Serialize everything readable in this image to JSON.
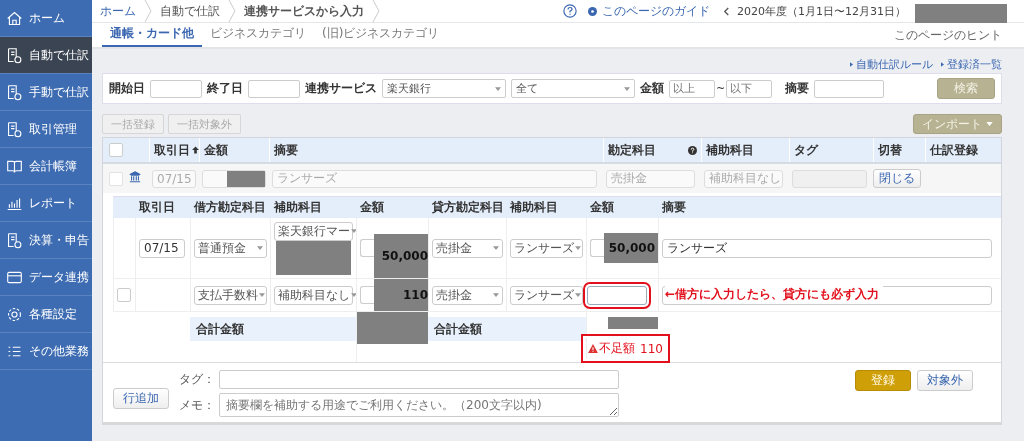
{
  "sidebar": {
    "items": [
      {
        "label": "ホーム",
        "selected": false
      },
      {
        "label": "自動で仕訳",
        "selected": true
      },
      {
        "label": "手動で仕訳",
        "selected": false
      },
      {
        "label": "取引管理",
        "selected": false
      },
      {
        "label": "会計帳簿",
        "selected": false
      },
      {
        "label": "レポート",
        "selected": false
      },
      {
        "label": "決算・申告",
        "selected": false
      },
      {
        "label": "データ連携",
        "selected": false
      },
      {
        "label": "各種設定",
        "selected": false
      },
      {
        "label": "その他業務",
        "selected": false
      }
    ]
  },
  "breadcrumb": [
    "ホーム",
    "自動で仕訳",
    "連携サービスから入力"
  ],
  "header": {
    "guide_link": "このページのガイド",
    "fiscal_year": "2020年度（1月1日〜12月31日）",
    "hint_link": "このページのヒント"
  },
  "tabs": [
    {
      "label": "通帳・カード他",
      "selected": true
    },
    {
      "label": "ビジネスカテゴリ",
      "selected": false
    },
    {
      "label": "(旧)ビジネスカテゴリ",
      "selected": false
    }
  ],
  "links": [
    "自動仕訳ルール",
    "登録済一覧"
  ],
  "filters": {
    "start_label": "開始日",
    "end_label": "終了日",
    "service_label": "連携サービス",
    "service_value": "楽天銀行",
    "category_value": "全て",
    "amount_label": "金額",
    "amount_min_placeholder": "以上",
    "tilde": "~",
    "amount_max_placeholder": "以下",
    "memo_label": "摘要",
    "search_button": "検索"
  },
  "bulk_buttons": [
    "一括登録",
    "一括対象外"
  ],
  "import_button": "インポート",
  "table": {
    "all_checked": false,
    "columns": [
      "取引日",
      "金額",
      "摘要",
      "勘定科目",
      "補助科目",
      "タグ",
      "切替",
      "仕訳登録"
    ],
    "row": {
      "checked": false,
      "date": "07/15",
      "memo": "ランサーズ",
      "account": "売掛金",
      "sub_account": "補助科目なし",
      "toggle_button": "閉じる"
    }
  },
  "entry": {
    "columns": [
      "取引日",
      "借方勘定科目",
      "補助科目",
      "金額",
      "貸方勘定科目",
      "補助科目",
      "金額",
      "摘要"
    ],
    "rows": [
      {
        "kind": "primary",
        "date": "07/15",
        "debit_account": "普通預金",
        "debit_sub": "楽天銀行マー",
        "debit_amount": "50,000",
        "credit_account": "売掛金",
        "credit_sub": "ランサーズ",
        "credit_amount": "50,000",
        "credit_flagged": false,
        "memo": "ランサーズ"
      },
      {
        "kind": "additional",
        "checked": false,
        "debit_account": "支払手数料",
        "debit_sub": "補助科目なし",
        "debit_amount": "110",
        "credit_account": "売掛金",
        "credit_sub": "ランサーズ",
        "credit_amount": "",
        "credit_flagged": true,
        "annotation": "←借方に入力したら、貸方にも必ず入力"
      }
    ],
    "total_label": "合計金額",
    "credit_total_label": "合計金額",
    "shortage": {
      "label": "不足額",
      "value": "110",
      "flagged": true
    }
  },
  "footer": {
    "add_row_button": "行追加",
    "tag_label": "タグ：",
    "memo_label": "メモ：",
    "memo_placeholder": "摘要欄を補助する用途でご利用ください。（200文字以内)",
    "register_button": "登録",
    "exclude_button": "対象外"
  }
}
